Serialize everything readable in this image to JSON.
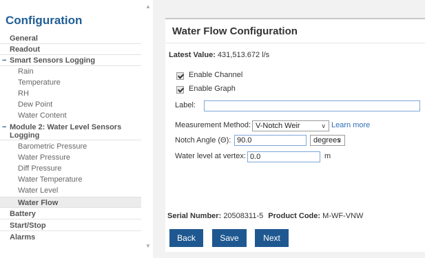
{
  "sidebar": {
    "title": "Configuration",
    "items": [
      {
        "label": "General",
        "level": 0
      },
      {
        "label": "Readout",
        "level": 0
      },
      {
        "label": "Smart Sensors Logging",
        "level": 0,
        "expanded": true
      },
      {
        "label": "Rain",
        "level": 1
      },
      {
        "label": "Temperature",
        "level": 1
      },
      {
        "label": "RH",
        "level": 1
      },
      {
        "label": "Dew Point",
        "level": 1
      },
      {
        "label": "Water Content",
        "level": 1
      },
      {
        "label": "Module 2: Water Level Sensors Logging",
        "level": 0,
        "expanded": true
      },
      {
        "label": "Barometric Pressure",
        "level": 1
      },
      {
        "label": "Water Pressure",
        "level": 1
      },
      {
        "label": "Diff Pressure",
        "level": 1
      },
      {
        "label": "Water Temperature",
        "level": 1
      },
      {
        "label": "Water Level",
        "level": 1
      },
      {
        "label": "Water Flow",
        "level": 1,
        "active": true
      },
      {
        "label": "Battery",
        "level": 0
      },
      {
        "label": "Start/Stop",
        "level": 0
      },
      {
        "label": "Alarms",
        "level": 0
      }
    ],
    "collapse_glyph": "−"
  },
  "panel": {
    "title": "Water Flow Configuration",
    "latest_value_label": "Latest Value:",
    "latest_value": "431,513.672 l/s",
    "enable_channel_label": "Enable Channel",
    "enable_channel_checked": true,
    "enable_graph_label": "Enable Graph",
    "enable_graph_checked": true,
    "label_label": "Label:",
    "label_value": "",
    "measurement_method_label": "Measurement Method:",
    "measurement_method_value": "V-Notch Weir",
    "learn_more": "Learn more",
    "notch_angle_label": "Notch Angle (Θ):",
    "notch_angle_value": "90.0",
    "notch_angle_unit": "degrees",
    "water_level_label": "Water level at vertex:",
    "water_level_value": "0.0",
    "water_level_unit": "m",
    "serial_label": "Serial Number:",
    "serial_value": "20508311-5",
    "product_label": "Product Code:",
    "product_value": "M-WF-VNW"
  },
  "buttons": {
    "back": "Back",
    "save": "Save",
    "next": "Next"
  },
  "colors": {
    "brand_blue": "#1f5890",
    "title_blue": "#1f5d96",
    "link_blue": "#2f6fb6"
  },
  "icons": {
    "scroll_up": "chevron-up-icon",
    "scroll_down": "chevron-down-icon",
    "select_caret": "chevron-down-icon"
  }
}
